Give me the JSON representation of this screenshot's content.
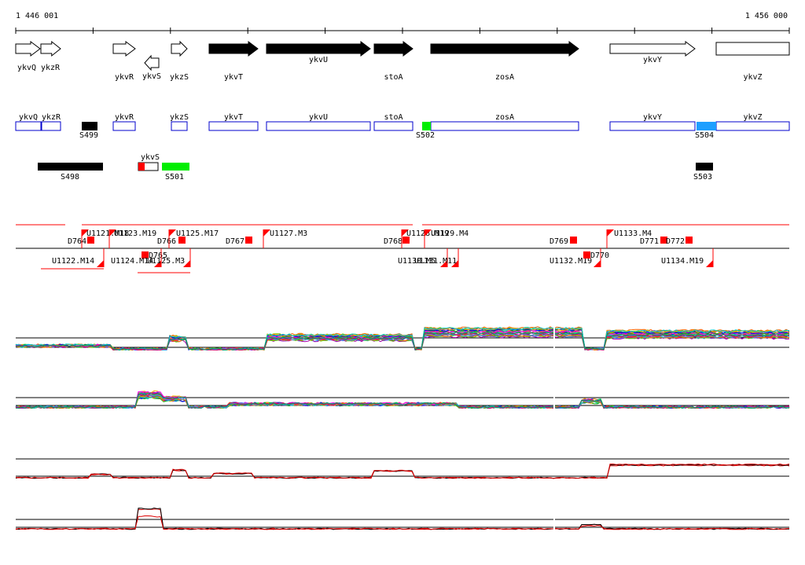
{
  "coords": {
    "start": "1 446 001",
    "end": "1 456 000"
  },
  "genes": [
    {
      "label": "ykvQ",
      "filled": false,
      "dir": "right",
      "label_pos": "below-left"
    },
    {
      "label": "ykzR",
      "filled": false,
      "dir": "right",
      "label_pos": "below"
    },
    {
      "label": "ykvR",
      "filled": false,
      "dir": "right",
      "label_pos": "below"
    },
    {
      "label": "ykvS",
      "filled": false,
      "dir": "left",
      "label_pos": "below"
    },
    {
      "label": "ykzS",
      "filled": false,
      "dir": "right",
      "label_pos": "below"
    },
    {
      "label": "ykvT",
      "filled": true,
      "dir": "right",
      "label_pos": "below"
    },
    {
      "label": "ykvU",
      "filled": true,
      "dir": "right",
      "label_pos": "above"
    },
    {
      "label": "stoA",
      "filled": true,
      "dir": "right",
      "label_pos": "below"
    },
    {
      "label": "zosA",
      "filled": true,
      "dir": "right",
      "label_pos": "below"
    },
    {
      "label": "ykvY",
      "filled": false,
      "dir": "right",
      "label_pos": "above"
    },
    {
      "label": "ykvZ",
      "filled": false,
      "dir": "right",
      "label_pos": "below"
    }
  ],
  "gene_boxes": [
    "ykvQ",
    "ykzR",
    "ykvR",
    "ykzS",
    "ykvT",
    "ykvU",
    "stoA",
    "zosA",
    "ykvY",
    "ykvZ"
  ],
  "segments": [
    {
      "label": "S499",
      "color": "#000000"
    },
    {
      "label": "S502",
      "color": "#00ee00"
    },
    {
      "label": "S504",
      "color": "#1e9fff"
    },
    {
      "label": "S498",
      "color": "#000000"
    },
    {
      "label": "S501",
      "color": "#00ee00"
    },
    {
      "label": "S503",
      "color": "#000000"
    }
  ],
  "ykvs_box_label": "ykvS",
  "features_top": [
    "D764",
    "U1121.M18",
    "U1123.M19",
    "D766",
    "U1125.M17",
    "D767",
    "U1127.M3",
    "D768",
    "U1128.M19",
    "U1129.M4",
    "D769",
    "U1133.M4",
    "D771",
    "D772"
  ],
  "features_bottom": [
    "U1122.M14",
    "D765",
    "U1124.M14",
    "U1125.M3",
    "U1130.M5",
    "U1131.M11",
    "U1132.M19",
    "D770",
    "U1134.M19"
  ],
  "colors": {
    "feature_red": "#ff0000",
    "box_blue": "#0000cc",
    "plot_red": "#dd0000"
  }
}
